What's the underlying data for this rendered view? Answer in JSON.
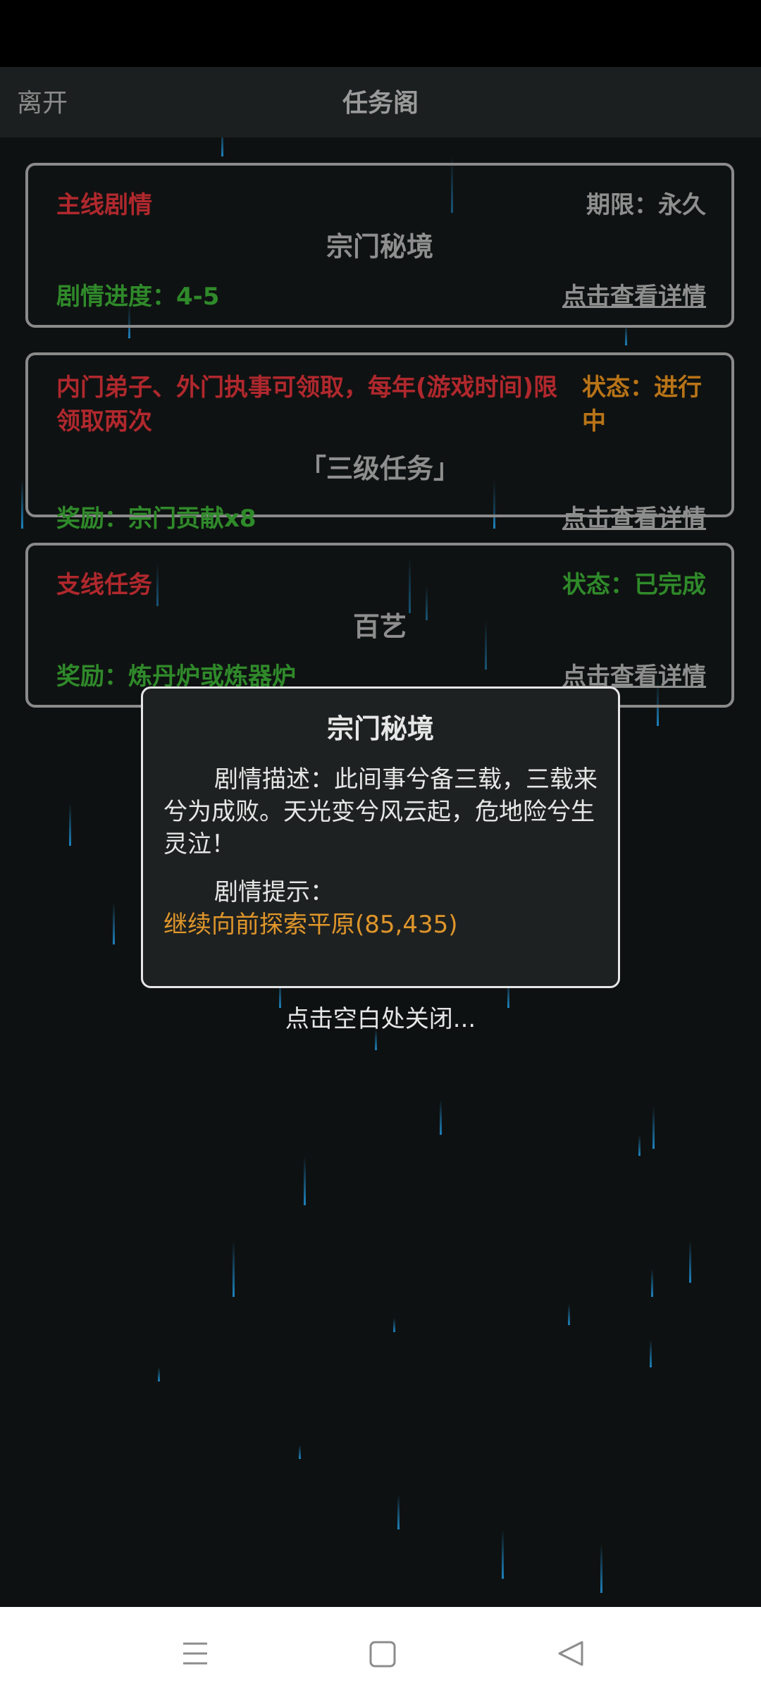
{
  "header": {
    "leave_label": "离开",
    "title": "任务阁"
  },
  "tasks": [
    {
      "type_label": "主线剧情",
      "status_label": "期限：永久",
      "name": "宗门秘境",
      "progress_label": "剧情进度：4-5",
      "detail_link": "点击查看详情"
    },
    {
      "type_label": "内门弟子、外门执事可领取，每年(游戏时间)限领取两次",
      "status_label": "状态：进行中",
      "name": "「三级任务」",
      "reward_label": "奖励：宗门贡献x8",
      "detail_link": "点击查看详情"
    },
    {
      "type_label": "支线任务",
      "status_label": "状态：已完成",
      "name": "百艺",
      "reward_label": "奖励：炼丹炉或炼器炉",
      "detail_link": "点击查看详情"
    }
  ],
  "dialog": {
    "title": "宗门秘境",
    "description": "剧情描述：此间事兮备三载，三载来兮为成败。天光变兮风云起，危地险兮生灵泣！",
    "hint_label": "剧情提示：",
    "hint_text": "继续向前探索平原(85,435)",
    "close_hint": "点击空白处关闭..."
  },
  "navbar": {
    "menu_icon": "menu-icon",
    "home_icon": "home-square-icon",
    "back_icon": "back-triangle-icon"
  },
  "colors": {
    "background": "#0e1111",
    "red": "#b0282d",
    "green": "#2f8a2a",
    "orange": "#b97417",
    "hint_orange": "#e0962a"
  }
}
